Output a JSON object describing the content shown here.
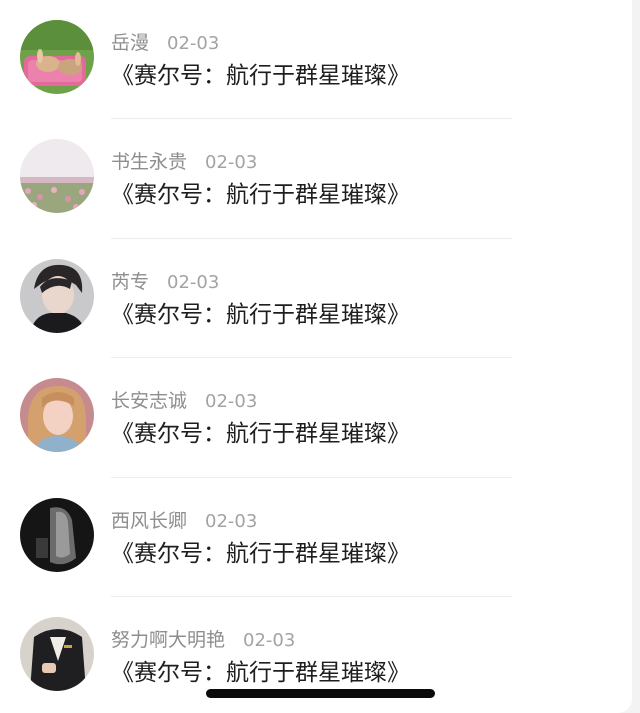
{
  "messages": [
    {
      "name": "岳漫",
      "date": "02-03",
      "text": "《赛尔号：航行于群星璀璨》"
    },
    {
      "name": "书生永贵",
      "date": "02-03",
      "text": "《赛尔号：航行于群星璀璨》"
    },
    {
      "name": "芮专",
      "date": "02-03",
      "text": "《赛尔号：航行于群星璀璨》"
    },
    {
      "name": "长安志诚",
      "date": "02-03",
      "text": "《赛尔号：航行于群星璀璨》"
    },
    {
      "name": "西风长卿",
      "date": "02-03",
      "text": "《赛尔号：航行于群星璀璨》"
    },
    {
      "name": "努力啊大明艳",
      "date": "02-03",
      "text": "《赛尔号：航行于群星璀璨》"
    }
  ],
  "colors": {
    "name_text": "#8e8e8e",
    "date_text": "#a3a3a3",
    "message_text": "#1e1e1e",
    "card_background": "#ffffff",
    "page_background": "#f3f3f3",
    "home_indicator": "#0b0b0b"
  }
}
